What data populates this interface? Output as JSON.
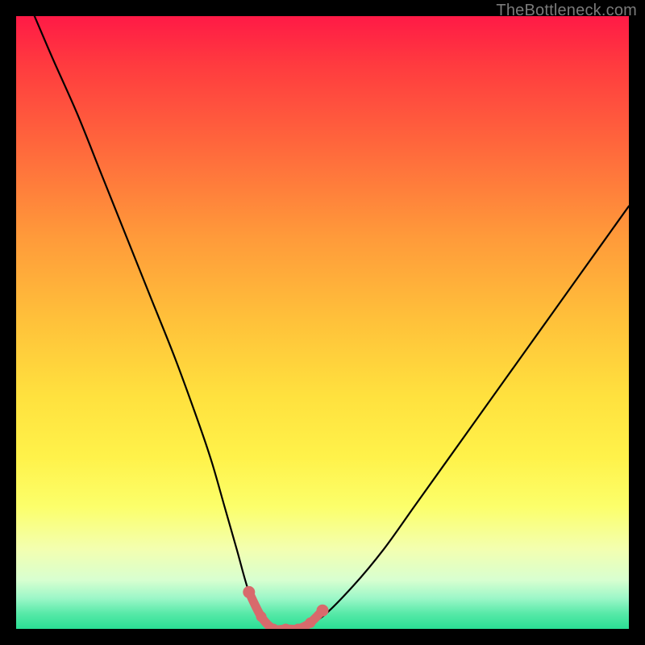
{
  "watermark": "TheBottleneck.com",
  "colors": {
    "gradient_top": "#ff1a46",
    "gradient_bottom": "#2adf95",
    "curve": "#000000",
    "knot": "#d86a6c",
    "frame_bg": "#000000"
  },
  "chart_data": {
    "type": "line",
    "title": "",
    "xlabel": "",
    "ylabel": "",
    "xlim": [
      0,
      100
    ],
    "ylim": [
      0,
      100
    ],
    "grid": false,
    "legend": false,
    "series": [
      {
        "name": "bottleneck-curve",
        "x": [
          3,
          6,
          10,
          14,
          18,
          22,
          26,
          30,
          32,
          34,
          36,
          38,
          40,
          42,
          44,
          46,
          50,
          55,
          60,
          65,
          70,
          75,
          80,
          85,
          90,
          95,
          100
        ],
        "y": [
          100,
          93,
          84,
          74,
          64,
          54,
          44,
          33,
          27,
          20,
          13,
          6,
          2,
          0,
          0,
          0,
          2,
          7,
          13,
          20,
          27,
          34,
          41,
          48,
          55,
          62,
          69
        ]
      }
    ],
    "highlight_segment": {
      "name": "flat-minimum-knots",
      "x": [
        38,
        40,
        42,
        44,
        46,
        48,
        50
      ],
      "y": [
        6,
        2,
        0,
        0,
        0,
        1,
        3
      ]
    }
  }
}
